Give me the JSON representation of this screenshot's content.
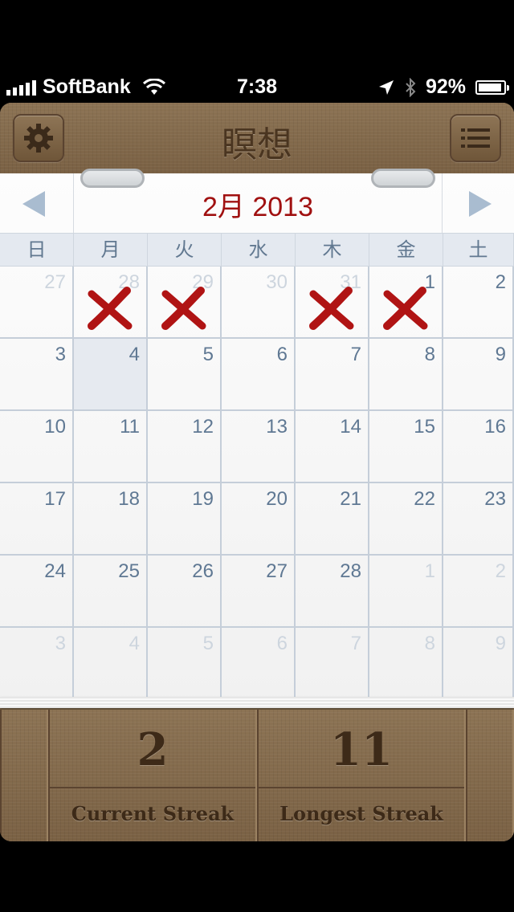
{
  "status_bar": {
    "carrier": "SoftBank",
    "time": "7:38",
    "battery": "92%",
    "battery_level": 0.92
  },
  "header": {
    "title": "瞑想",
    "settings_icon": "gear-icon",
    "list_icon": "list-icon"
  },
  "calendar": {
    "month_title": "2月 2013",
    "weekdays": [
      "日",
      "月",
      "火",
      "水",
      "木",
      "金",
      "土"
    ],
    "weeks": [
      [
        {
          "d": "27",
          "muted": true
        },
        {
          "d": "28",
          "muted": true,
          "x": true
        },
        {
          "d": "29",
          "muted": true,
          "x": true
        },
        {
          "d": "30",
          "muted": true
        },
        {
          "d": "31",
          "muted": true,
          "x": true
        },
        {
          "d": "1",
          "x": true
        },
        {
          "d": "2"
        }
      ],
      [
        {
          "d": "3"
        },
        {
          "d": "4",
          "today": true
        },
        {
          "d": "5"
        },
        {
          "d": "6"
        },
        {
          "d": "7"
        },
        {
          "d": "8"
        },
        {
          "d": "9"
        }
      ],
      [
        {
          "d": "10"
        },
        {
          "d": "11"
        },
        {
          "d": "12"
        },
        {
          "d": "13"
        },
        {
          "d": "14"
        },
        {
          "d": "15"
        },
        {
          "d": "16"
        }
      ],
      [
        {
          "d": "17"
        },
        {
          "d": "18"
        },
        {
          "d": "19"
        },
        {
          "d": "20"
        },
        {
          "d": "21"
        },
        {
          "d": "22"
        },
        {
          "d": "23"
        }
      ],
      [
        {
          "d": "24"
        },
        {
          "d": "25"
        },
        {
          "d": "26"
        },
        {
          "d": "27"
        },
        {
          "d": "28"
        },
        {
          "d": "1",
          "muted": true
        },
        {
          "d": "2",
          "muted": true
        }
      ],
      [
        {
          "d": "3",
          "muted": true
        },
        {
          "d": "4",
          "muted": true
        },
        {
          "d": "5",
          "muted": true
        },
        {
          "d": "6",
          "muted": true
        },
        {
          "d": "7",
          "muted": true
        },
        {
          "d": "8",
          "muted": true
        },
        {
          "d": "9",
          "muted": true
        }
      ]
    ],
    "mark_color": "#b01414"
  },
  "stats": {
    "current_streak_value": "2",
    "current_streak_label": "Current Streak",
    "longest_streak_value": "11",
    "longest_streak_label": "Longest Streak"
  }
}
